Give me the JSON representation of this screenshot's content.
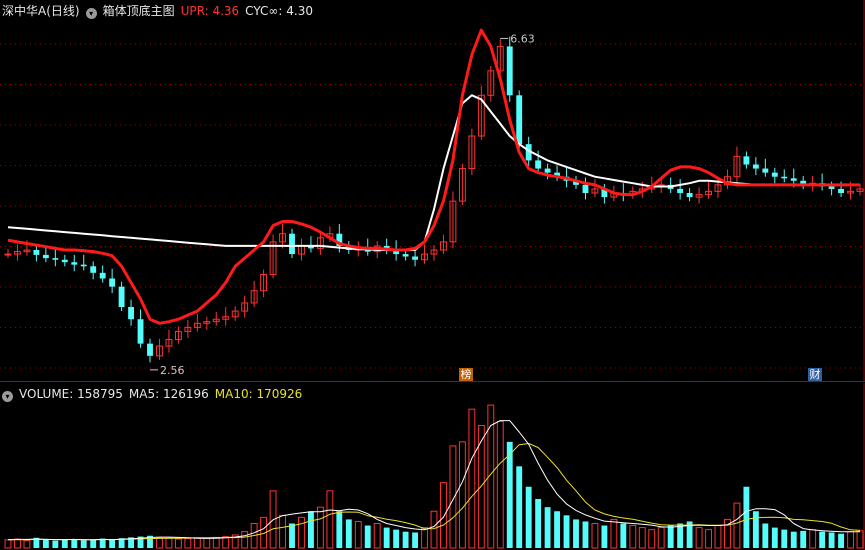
{
  "main_header": {
    "stock": "深中华A(日线)",
    "indicator": "箱体顶底主图",
    "upr_label": "UPR: 4.36",
    "cyc_label": "CYC∞: 4.30"
  },
  "vol_header": {
    "volume_label": "VOLUME: 158795",
    "ma5_label": "MA5: 126196",
    "ma10_label": "MA10: 170926"
  },
  "annotations": {
    "high_label": "6.63",
    "low_label": "2.56"
  },
  "badges": {
    "bang": "榜",
    "cai": "财"
  },
  "colors": {
    "up": "#ff3232",
    "down": "#54fcfc",
    "upr_line": "#ff1a1a",
    "cyc_line": "#ffffff",
    "ma5": "#ffffff",
    "ma10": "#e8e02a",
    "grid": "#a00000",
    "badge_bang": "#c06000",
    "badge_cai": "#3060a0"
  },
  "chart_data": [
    {
      "type": "line",
      "y_price_range": [
        2.5,
        6.7
      ],
      "candles_close": [
        3.85,
        3.88,
        3.9,
        3.84,
        3.8,
        3.78,
        3.75,
        3.72,
        3.7,
        3.62,
        3.55,
        3.45,
        3.2,
        3.05,
        2.75,
        2.6,
        2.72,
        2.8,
        2.9,
        2.95,
        3.0,
        3.02,
        3.05,
        3.08,
        3.15,
        3.25,
        3.4,
        3.6,
        4.0,
        4.1,
        3.85,
        3.95,
        3.92,
        4.05,
        4.1,
        3.95,
        3.9,
        3.92,
        3.88,
        3.95,
        3.9,
        3.85,
        3.82,
        3.78,
        3.85,
        3.9,
        4.0,
        4.5,
        4.9,
        5.3,
        5.8,
        6.1,
        6.4,
        5.8,
        5.2,
        5.0,
        4.9,
        4.85,
        4.8,
        4.75,
        4.7,
        4.6,
        4.65,
        4.55,
        4.6,
        4.58,
        4.62,
        4.65,
        4.68,
        4.7,
        4.65,
        4.6,
        4.55,
        4.58,
        4.62,
        4.7,
        4.8,
        5.05,
        4.95,
        4.9,
        4.85,
        4.8,
        4.78,
        4.75,
        4.7,
        4.72,
        4.68,
        4.65,
        4.6,
        4.62,
        4.65
      ],
      "upr": [
        4.02,
        4.0,
        3.98,
        3.96,
        3.94,
        3.92,
        3.9,
        3.9,
        3.89,
        3.88,
        3.86,
        3.83,
        3.7,
        3.5,
        3.3,
        3.05,
        3.0,
        3.02,
        3.05,
        3.1,
        3.15,
        3.25,
        3.35,
        3.5,
        3.7,
        3.8,
        3.9,
        4.0,
        4.2,
        4.25,
        4.25,
        4.22,
        4.18,
        4.12,
        4.05,
        3.98,
        3.95,
        3.93,
        3.92,
        3.92,
        3.91,
        3.9,
        3.9,
        3.92,
        4.0,
        4.2,
        4.5,
        5.0,
        5.8,
        6.3,
        6.6,
        6.4,
        6.0,
        5.5,
        5.1,
        4.9,
        4.85,
        4.82,
        4.8,
        4.78,
        4.75,
        4.72,
        4.7,
        4.65,
        4.6,
        4.58,
        4.58,
        4.62,
        4.68,
        4.78,
        4.88,
        4.92,
        4.92,
        4.9,
        4.85,
        4.78,
        4.72,
        4.7,
        4.7,
        4.7,
        4.7,
        4.7,
        4.7,
        4.7,
        4.7,
        4.7,
        4.7,
        4.7,
        4.7,
        4.7,
        4.7
      ],
      "cyc": [
        4.18,
        4.17,
        4.16,
        4.15,
        4.14,
        4.13,
        4.12,
        4.11,
        4.1,
        4.09,
        4.08,
        4.07,
        4.06,
        4.05,
        4.04,
        4.03,
        4.02,
        4.01,
        4.0,
        3.99,
        3.98,
        3.97,
        3.96,
        3.95,
        3.95,
        3.95,
        3.95,
        3.95,
        3.95,
        3.95,
        3.95,
        3.95,
        3.95,
        3.95,
        3.94,
        3.93,
        3.92,
        3.91,
        3.91,
        3.9,
        3.9,
        3.9,
        3.9,
        3.9,
        4.0,
        4.4,
        4.9,
        5.3,
        5.7,
        5.8,
        5.75,
        5.6,
        5.45,
        5.3,
        5.2,
        5.12,
        5.06,
        5.0,
        4.96,
        4.92,
        4.88,
        4.84,
        4.8,
        4.78,
        4.76,
        4.74,
        4.72,
        4.7,
        4.68,
        4.68,
        4.68,
        4.7,
        4.72,
        4.75,
        4.75,
        4.74,
        4.73,
        4.72,
        4.71,
        4.7,
        4.7,
        4.7,
        4.7,
        4.7,
        4.7,
        4.7,
        4.7,
        4.7,
        4.7,
        4.7,
        4.7
      ]
    },
    {
      "type": "bar",
      "y_volume_range": [
        0,
        360000
      ],
      "volume": [
        20000,
        22000,
        18000,
        25000,
        20000,
        18000,
        22000,
        21000,
        19000,
        20000,
        23000,
        21000,
        24000,
        26000,
        28000,
        30000,
        26000,
        24000,
        22000,
        23000,
        25000,
        24000,
        26000,
        28000,
        32000,
        40000,
        60000,
        75000,
        140000,
        80000,
        60000,
        75000,
        90000,
        100000,
        140000,
        90000,
        70000,
        65000,
        55000,
        60000,
        50000,
        45000,
        40000,
        38000,
        50000,
        90000,
        160000,
        250000,
        260000,
        340000,
        300000,
        350000,
        310000,
        260000,
        200000,
        150000,
        120000,
        100000,
        90000,
        80000,
        70000,
        65000,
        60000,
        55000,
        70000,
        60000,
        55000,
        50000,
        45000,
        50000,
        55000,
        60000,
        65000,
        50000,
        45000,
        55000,
        70000,
        110000,
        150000,
        90000,
        60000,
        50000,
        45000,
        40000,
        42000,
        45000,
        40000,
        38000,
        35000,
        40000,
        42000
      ],
      "ma5": [
        20000,
        21000,
        21000,
        22000,
        21000,
        20500,
        20500,
        21000,
        20000,
        20000,
        21000,
        20500,
        21500,
        22500,
        24000,
        25800,
        26800,
        26800,
        26000,
        25000,
        24000,
        23600,
        24000,
        25000,
        27000,
        30000,
        37200,
        47200,
        69400,
        79000,
        83000,
        86000,
        89000,
        89000,
        93000,
        91000,
        95000,
        93000,
        84000,
        70000,
        60000,
        55000,
        50000,
        46600,
        44600,
        52600,
        75600,
        118000,
        162000,
        220000,
        262000,
        300000,
        312000,
        312000,
        284000,
        254000,
        208000,
        166000,
        132000,
        108000,
        92000,
        81000,
        73000,
        66000,
        64000,
        62000,
        60000,
        58000,
        56000,
        52000,
        51000,
        53000,
        55000,
        56000,
        55000,
        55000,
        57000,
        70000,
        90000,
        96000,
        96000,
        94000,
        81000,
        60000,
        47400,
        44400,
        42400,
        41000,
        40000,
        40000,
        40000
      ],
      "ma10": [
        20000,
        20500,
        20000,
        21000,
        21000,
        20500,
        20500,
        20800,
        20400,
        20400,
        20600,
        20600,
        21000,
        21500,
        22500,
        23000,
        23500,
        23800,
        24100,
        24500,
        25000,
        25300,
        25500,
        25500,
        25500,
        26800,
        30500,
        35500,
        47000,
        50500,
        54600,
        59400,
        66400,
        71200,
        82600,
        87500,
        88200,
        87500,
        79000,
        75500,
        70500,
        67200,
        62200,
        56000,
        47200,
        47600,
        56300,
        74000,
        97500,
        126600,
        151600,
        181000,
        208000,
        229000,
        253000,
        256000,
        246000,
        222000,
        197000,
        166000,
        140000,
        112500,
        93000,
        83500,
        77500,
        73500,
        70500,
        65500,
        61000,
        57000,
        56000,
        56000,
        56000,
        57000,
        55500,
        55500,
        56000,
        61000,
        70000,
        74000,
        75000,
        75500,
        74000,
        70000,
        69000,
        67000,
        65000,
        60500,
        51500,
        44500,
        43000
      ]
    }
  ]
}
